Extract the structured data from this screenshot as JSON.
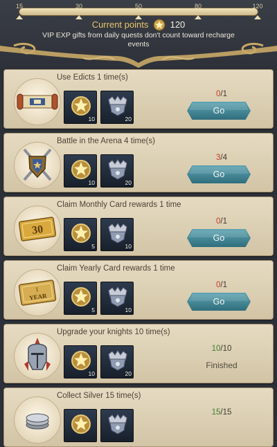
{
  "header": {
    "milestones": [
      "15",
      "30",
      "50",
      "80",
      "120"
    ],
    "points_label": "Current points",
    "points_value": "120",
    "note": "VIP EXP gifts from daily quests don't count toward recharge events"
  },
  "quests": [
    {
      "title": "Use Edicts 1 time(s)",
      "emblem": "scroll-icon",
      "rewards": [
        {
          "icon": "gold-medal-icon",
          "qty": "10"
        },
        {
          "icon": "silver-crown-badge-icon",
          "qty": "20"
        }
      ],
      "progress_current": "0",
      "progress_sep": "/",
      "progress_total": "1",
      "state": "go",
      "button_label": "Go"
    },
    {
      "title": "Battle in the Arena 4 time(s)",
      "emblem": "crossed-swords-shield-icon",
      "rewards": [
        {
          "icon": "gold-medal-icon",
          "qty": "10"
        },
        {
          "icon": "silver-crown-badge-icon",
          "qty": "20"
        }
      ],
      "progress_current": "3",
      "progress_sep": "/",
      "progress_total": "4",
      "state": "go",
      "button_label": "Go"
    },
    {
      "title": "Claim Monthly Card rewards 1 time",
      "emblem": "monthly-card-icon",
      "emblem_text": "30",
      "rewards": [
        {
          "icon": "gold-medal-icon",
          "qty": "5"
        },
        {
          "icon": "silver-crown-badge-icon",
          "qty": "10"
        }
      ],
      "progress_current": "0",
      "progress_sep": "/",
      "progress_total": "1",
      "state": "go",
      "button_label": "Go"
    },
    {
      "title": "Claim Yearly Card rewards 1 time",
      "emblem": "yearly-card-icon",
      "emblem_text_top": "1",
      "emblem_text_bottom": "YEAR",
      "rewards": [
        {
          "icon": "gold-medal-icon",
          "qty": "5"
        },
        {
          "icon": "silver-crown-badge-icon",
          "qty": "10"
        }
      ],
      "progress_current": "0",
      "progress_sep": "/",
      "progress_total": "1",
      "state": "go",
      "button_label": "Go"
    },
    {
      "title": "Upgrade your knights 10 time(s)",
      "emblem": "knight-helmet-icon",
      "rewards": [
        {
          "icon": "gold-medal-icon",
          "qty": "10"
        },
        {
          "icon": "silver-crown-badge-icon",
          "qty": "20"
        }
      ],
      "progress_current": "10",
      "progress_sep": "/",
      "progress_total": "10",
      "state": "finished",
      "status_label": "Finished"
    },
    {
      "title": "Collect Silver 15 time(s)",
      "emblem": "silver-coins-icon",
      "rewards": [
        {
          "icon": "gold-medal-icon",
          "qty": ""
        },
        {
          "icon": "silver-crown-badge-icon",
          "qty": ""
        }
      ],
      "progress_current": "15",
      "progress_sep": "/",
      "progress_total": "15",
      "state": "finished",
      "status_label": ""
    }
  ],
  "colors": {
    "progress_incomplete": "#c33f25",
    "progress_complete": "#3f7f2a",
    "go_button": "#4a8c9b",
    "points_label": "#e7c56b"
  }
}
